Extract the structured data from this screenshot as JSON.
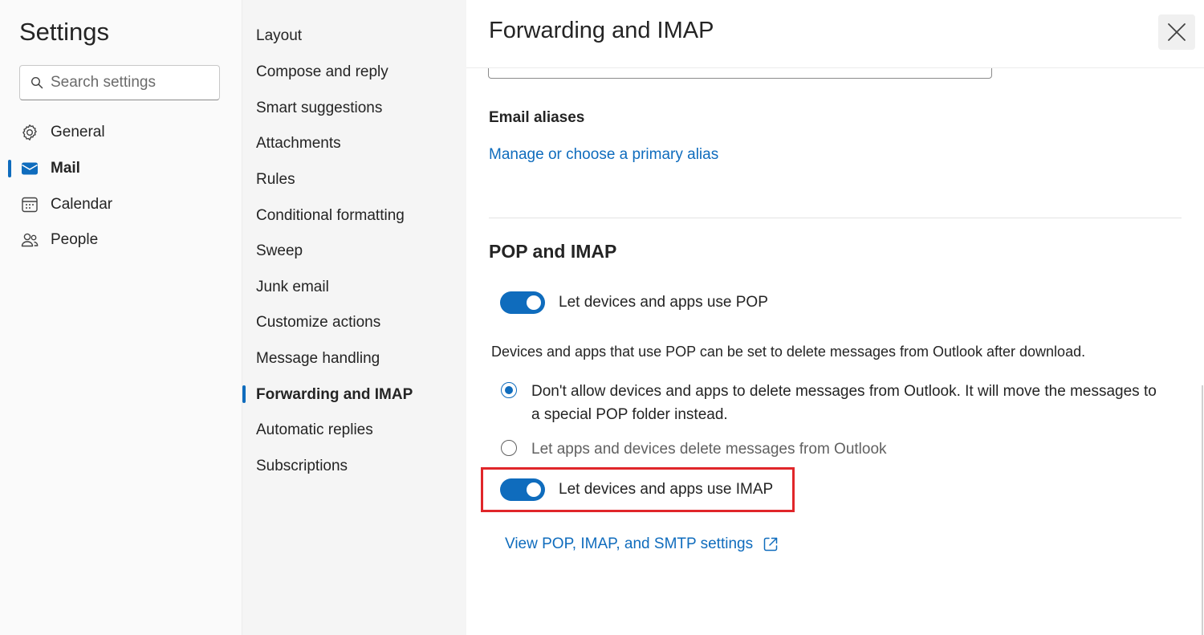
{
  "settings": {
    "title": "Settings",
    "search_placeholder": "Search settings"
  },
  "leftnav": {
    "items": [
      {
        "label": "General",
        "icon": "gear-icon"
      },
      {
        "label": "Mail",
        "icon": "mail-icon",
        "active": true
      },
      {
        "label": "Calendar",
        "icon": "calendar-icon"
      },
      {
        "label": "People",
        "icon": "people-icon"
      }
    ]
  },
  "midnav": {
    "items": [
      "Layout",
      "Compose and reply",
      "Smart suggestions",
      "Attachments",
      "Rules",
      "Conditional formatting",
      "Sweep",
      "Junk email",
      "Customize actions",
      "Message handling",
      "Forwarding and IMAP",
      "Automatic replies",
      "Subscriptions"
    ],
    "active_index": 10
  },
  "content": {
    "title": "Forwarding and IMAP",
    "email_aliases_label": "Email aliases",
    "alias_link": "Manage or choose a primary alias",
    "pop_imap_heading": "POP and IMAP",
    "pop_toggle_label": "Let devices and apps use POP",
    "pop_toggle_on": true,
    "pop_description": "Devices and apps that use POP can be set to delete messages from Outlook after download.",
    "radio_options": [
      {
        "line1": "Don't allow devices and apps to delete messages from Outlook. It will move the messages to",
        "line2": "a special POP folder instead.",
        "checked": true
      },
      {
        "line1": "Let apps and devices delete messages from Outlook",
        "line2": "",
        "checked": false
      }
    ],
    "imap_toggle_label": "Let devices and apps use IMAP",
    "imap_toggle_on": true,
    "settings_link": "View POP, IMAP, and SMTP settings"
  },
  "colors": {
    "accent": "#0f6cbd",
    "highlight": "#e0262a"
  }
}
